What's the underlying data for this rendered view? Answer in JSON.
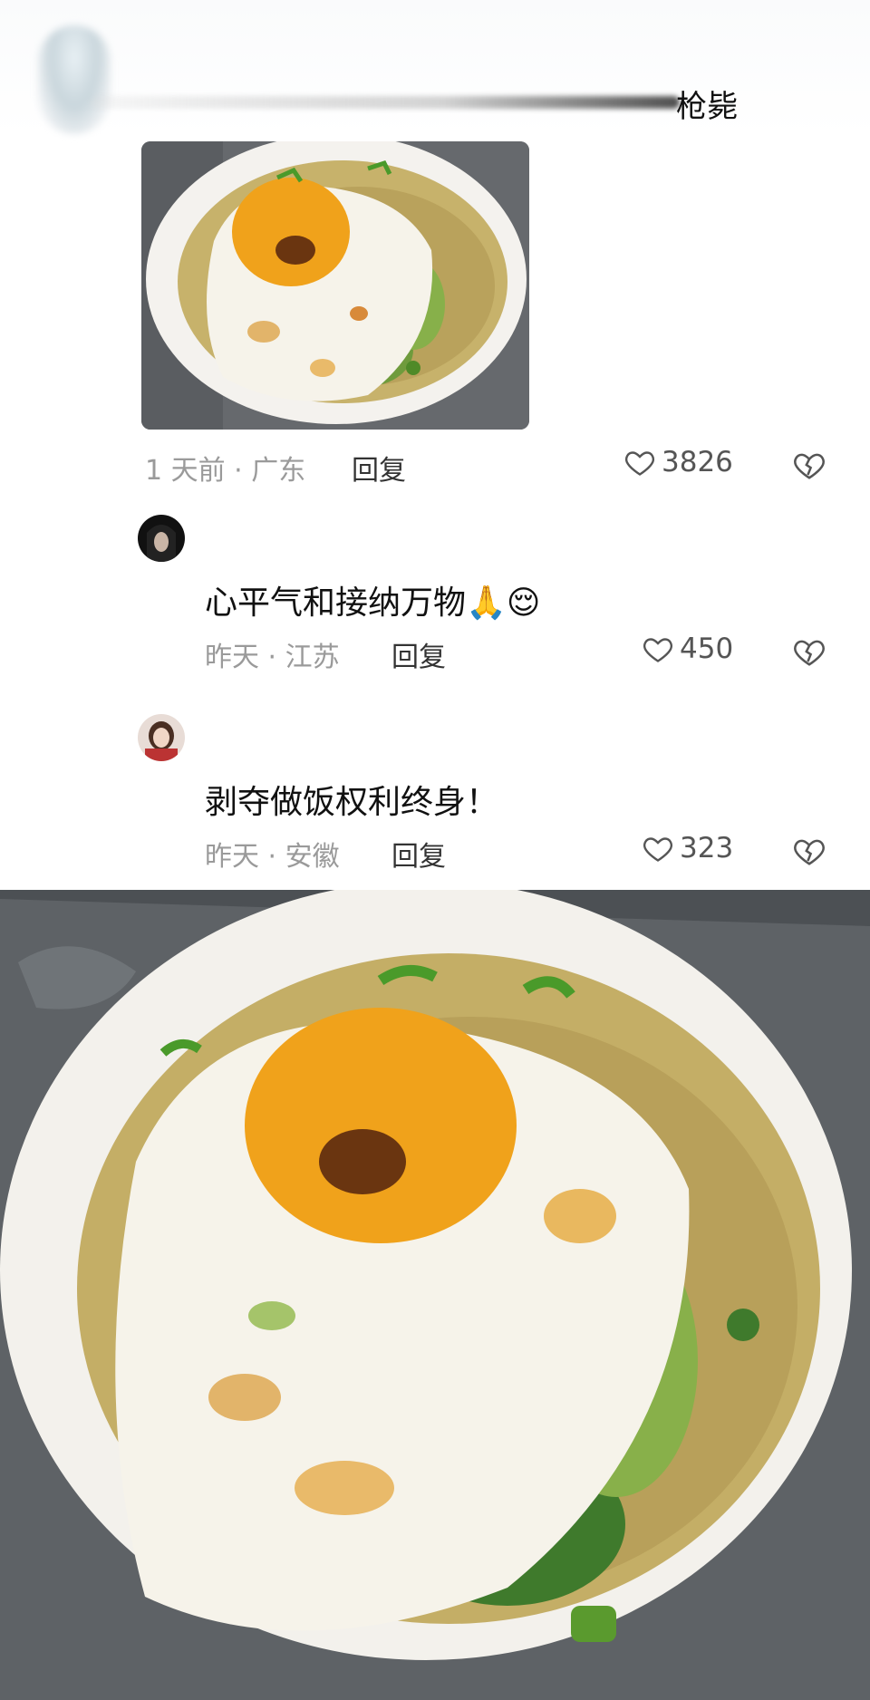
{
  "header": {
    "name": "枪毙"
  },
  "comments": [
    {
      "time": "1 天前",
      "location": "广东",
      "reply_label": "回复",
      "likes": "3826",
      "has_image": true
    },
    {
      "text": "心平气和接纳万物🙏😌",
      "time": "昨天",
      "location": "江苏",
      "reply_label": "回复",
      "likes": "450"
    },
    {
      "text": "剥夺做饭权利终身！",
      "time": "昨天",
      "location": "安徽",
      "reply_label": "回复",
      "likes": "323"
    }
  ],
  "colors": {
    "meta_gray": "#9a9a9a",
    "broth": "#c9b36a",
    "yolk": "#f2a81c"
  },
  "icons": {
    "like": "heart-outline-icon",
    "dislike": "broken-heart-icon"
  }
}
